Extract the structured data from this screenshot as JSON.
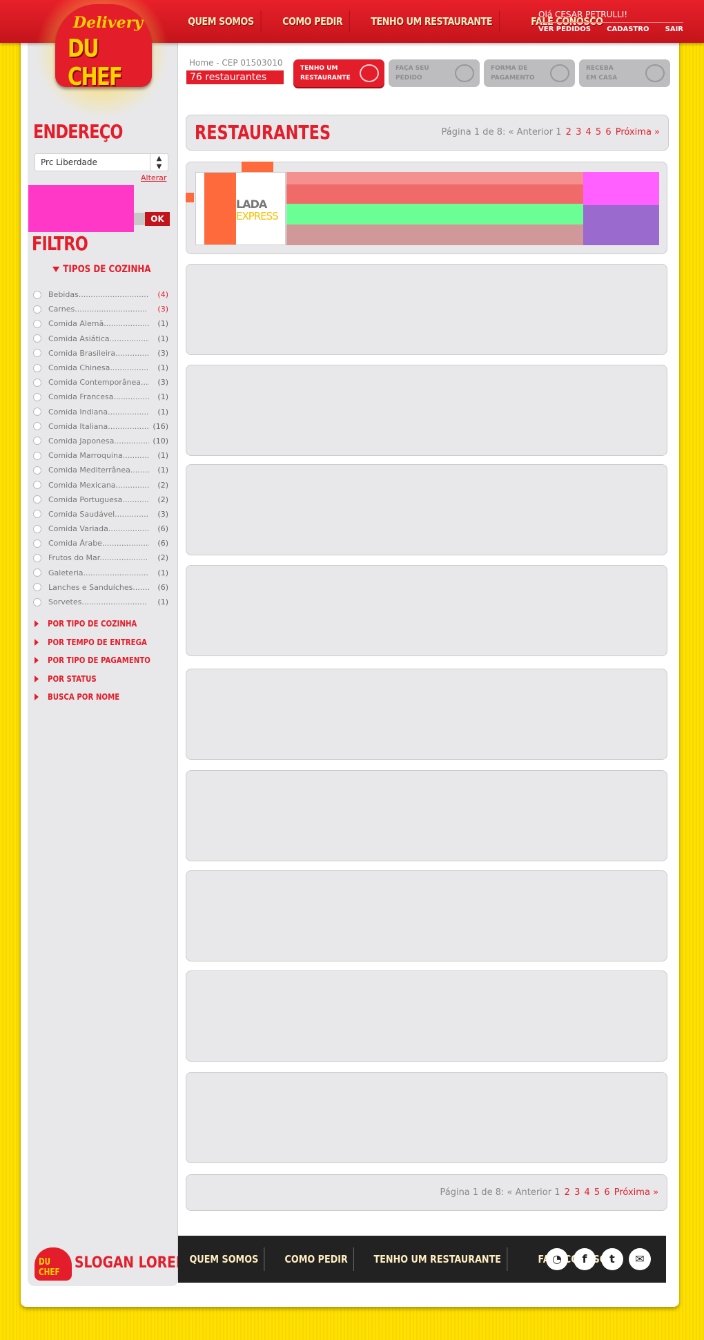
{
  "logo": {
    "line1": "Delivery",
    "line2": "DU CHEF"
  },
  "nav": [
    "QUEM SOMOS",
    "COMO PEDIR",
    "TENHO UM RESTAURANTE",
    "FALE CONOSCO"
  ],
  "user": {
    "greeting": "Olá CESAR PETRULLI!",
    "links": [
      "VER PEDIDOS",
      "CADASTRO",
      "SAIR"
    ]
  },
  "breadcrumb": "Home - CEP 01503010",
  "restaurant_count": "76 restaurantes",
  "steps": [
    {
      "line1": "TENHO UM",
      "line2": "RESTAURANTE"
    },
    {
      "line1": "FAÇA SEU",
      "line2": "PEDIDO"
    },
    {
      "line1": "FORMA DE",
      "line2": "PAGAMENTO"
    },
    {
      "line1": "RECEBA",
      "line2": "EM CASA"
    }
  ],
  "sidebar": {
    "address_title": "ENDEREÇO",
    "address_value": "Prc Liberdade",
    "alterar": "Alterar",
    "ok": "OK",
    "filter_title": "FILTRO",
    "tipos_title": "TIPOS DE COZINHA",
    "cuisines": [
      {
        "name": "Bebidas.............................",
        "count": "(4)",
        "highlight": true
      },
      {
        "name": "Carnes..............................",
        "count": "(3)",
        "highlight": true
      },
      {
        "name": "Comida Alemã...................",
        "count": "(1)"
      },
      {
        "name": "Comida Asiática.................",
        "count": "(1)"
      },
      {
        "name": "Comida Brasileira...............",
        "count": "(3)"
      },
      {
        "name": "Comida Chinesa.................",
        "count": "(1)"
      },
      {
        "name": "Comida Contemporânea......",
        "count": "(3)"
      },
      {
        "name": "Comida Francesa................",
        "count": "(1)"
      },
      {
        "name": "Comida Indiana...................",
        "count": "(1)"
      },
      {
        "name": "Comida Italiana..................",
        "count": "(16)"
      },
      {
        "name": "Comida Japonesa...............",
        "count": "(10)"
      },
      {
        "name": "Comida Marroquina.............",
        "count": "(1)"
      },
      {
        "name": "Comida Mediterrânea..........",
        "count": "(1)"
      },
      {
        "name": "Comida Mexicana................",
        "count": "(2)"
      },
      {
        "name": "Comida Portuguesa............",
        "count": "(2)"
      },
      {
        "name": "Comida Saudável...............",
        "count": "(3)"
      },
      {
        "name": "Comida Variada.................",
        "count": "(6)"
      },
      {
        "name": "Comida Árabe....................",
        "count": "(6)"
      },
      {
        "name": "Frutos do Mar....................",
        "count": "(2)"
      },
      {
        "name": "Galeteria...........................",
        "count": "(1)"
      },
      {
        "name": "Lanches e Sanduíches.......",
        "count": "(6)"
      },
      {
        "name": "Sorvetes...........................",
        "count": "(1)"
      }
    ],
    "sublinks": [
      "POR TIPO DE COZINHA",
      "POR TEMPO DE ENTREGA",
      "POR TIPO DE PAGAMENTO",
      "POR STATUS",
      "BUSCA POR NOME"
    ],
    "slogan": "SLOGAN LOREM",
    "slogan_logo": "DU CHEF"
  },
  "main": {
    "title": "RESTAURANTES",
    "pager": {
      "label": "Página 1 de 8:",
      "prev": "« Anterior",
      "current": "1",
      "pages": [
        "2",
        "3",
        "4",
        "5",
        "6"
      ],
      "next": "Próxima »"
    },
    "first_restaurant_logo": {
      "top": "LADA",
      "bottom": "EXPRESS"
    }
  },
  "footer": {
    "nav": [
      "QUEM SOMOS",
      "COMO PEDIR",
      "TENHO UM RESTAURANTE",
      "FALE CONOSCO"
    ],
    "social": [
      "rss-icon",
      "facebook-icon",
      "twitter-icon",
      "mail-icon"
    ]
  }
}
